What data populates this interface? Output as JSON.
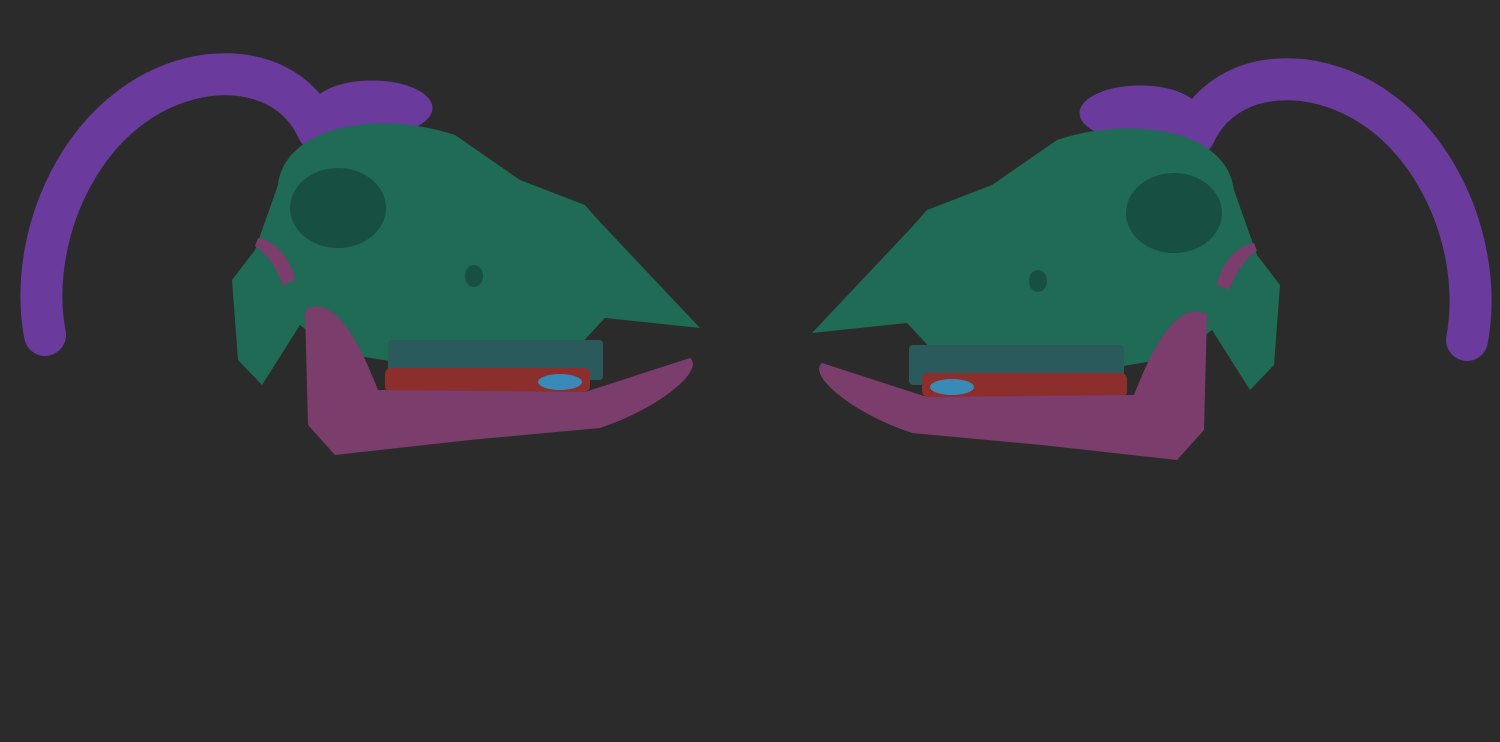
{
  "scene": {
    "background_color": "#2b2b2b",
    "colors": {
      "horn": "#6a3a9c",
      "horn_shade": "#51297a",
      "skull": "#1f6b55",
      "skull_shade": "#174f40",
      "jaw": "#7a3d6c",
      "jaw_shade": "#5e2e54",
      "teeth_upper": "#2b5a5c",
      "teeth_lower": "#8c2f2c",
      "tongue": "#3a8ab8"
    }
  }
}
